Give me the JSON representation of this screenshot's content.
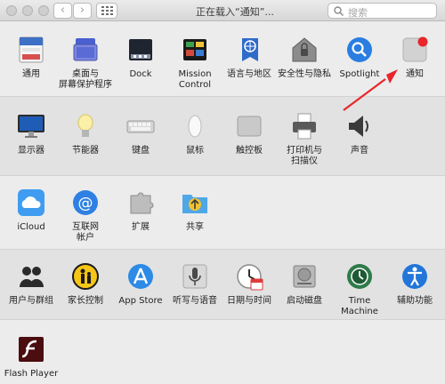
{
  "window": {
    "title": "正在载入“通知”...",
    "search_placeholder": "搜索",
    "back_symbol": "‹",
    "forward_symbol": "›"
  },
  "rows": [
    {
      "items": [
        {
          "label": "通用",
          "icon": "general-icon"
        },
        {
          "label": "桌面与\n屏幕保护程序",
          "icon": "desktop-screensaver-icon"
        },
        {
          "label": "Dock",
          "icon": "dock-icon"
        },
        {
          "label": "Mission\nControl",
          "icon": "mission-control-icon"
        },
        {
          "label": "语言与地区",
          "icon": "language-region-icon"
        },
        {
          "label": "安全性与隐私",
          "icon": "security-privacy-icon"
        },
        {
          "label": "Spotlight",
          "icon": "spotlight-icon"
        },
        {
          "label": "通知",
          "icon": "notifications-icon"
        }
      ]
    },
    {
      "items": [
        {
          "label": "显示器",
          "icon": "displays-icon"
        },
        {
          "label": "节能器",
          "icon": "energy-saver-icon"
        },
        {
          "label": "键盘",
          "icon": "keyboard-icon"
        },
        {
          "label": "鼠标",
          "icon": "mouse-icon"
        },
        {
          "label": "触控板",
          "icon": "trackpad-icon"
        },
        {
          "label": "打印机与\n扫描仪",
          "icon": "printers-scanners-icon"
        },
        {
          "label": "声音",
          "icon": "sound-icon"
        }
      ]
    },
    {
      "items": [
        {
          "label": "iCloud",
          "icon": "icloud-icon"
        },
        {
          "label": "互联网\n帐户",
          "icon": "internet-accounts-icon"
        },
        {
          "label": "扩展",
          "icon": "extensions-icon"
        },
        {
          "label": "共享",
          "icon": "sharing-icon"
        }
      ]
    },
    {
      "items": [
        {
          "label": "用户与群组",
          "icon": "users-groups-icon"
        },
        {
          "label": "家长控制",
          "icon": "parental-controls-icon"
        },
        {
          "label": "App Store",
          "icon": "app-store-icon"
        },
        {
          "label": "听写与语音",
          "icon": "dictation-speech-icon"
        },
        {
          "label": "日期与时间",
          "icon": "date-time-icon"
        },
        {
          "label": "启动磁盘",
          "icon": "startup-disk-icon"
        },
        {
          "label": "Time Machine",
          "icon": "time-machine-icon"
        },
        {
          "label": "辅助功能",
          "icon": "accessibility-icon"
        }
      ]
    },
    {
      "items": [
        {
          "label": "Flash Player",
          "icon": "flash-player-icon"
        }
      ]
    }
  ],
  "colors": {
    "annotation_arrow": "#e8262b",
    "notification_badge": "#e8262b"
  }
}
